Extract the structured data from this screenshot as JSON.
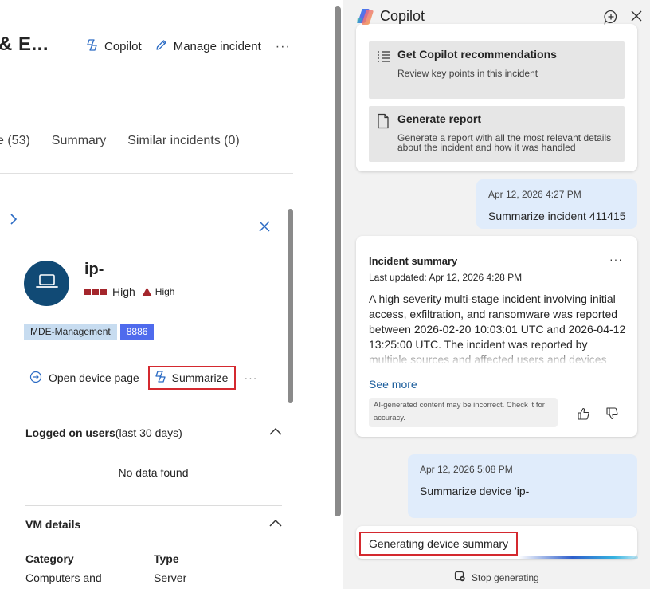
{
  "left": {
    "incident_title": "& E...",
    "actions": {
      "copilot": "Copilot",
      "manage": "Manage incident",
      "more": "···"
    },
    "tabs": [
      "e (53)",
      "Summary",
      "Similar incidents (0)"
    ],
    "device": {
      "name": "ip-",
      "risk_label": "High",
      "exposure_label": "High",
      "tags": [
        "MDE-Management",
        "8886"
      ],
      "open_page": "Open device page",
      "summarize": "Summarize",
      "more": "···"
    },
    "logged_on": {
      "title": "Logged on users",
      "subtitle": "(last 30 days)",
      "empty": "No data found"
    },
    "vm_details": {
      "title": "VM details",
      "category_label": "Category",
      "category_value": "Computers and",
      "type_label": "Type",
      "type_value": "Server"
    }
  },
  "copilot": {
    "title": "Copilot",
    "recommendations": [
      {
        "title": "Get Copilot recommendations",
        "desc": "Review key points in this incident",
        "icon": "list-icon"
      },
      {
        "title": "Generate report",
        "desc": "Generate a report with all the most relevant details about the incident and how it was handled",
        "icon": "document-icon"
      }
    ],
    "prompt1": {
      "time": "Apr 12, 2026 4:27 PM",
      "text": "Summarize incident 411415"
    },
    "summary": {
      "heading": "Incident summary",
      "updated": "Last updated: Apr 12, 2026 4:28 PM",
      "more": "···",
      "body": "A high severity multi-stage incident involving initial access, exfiltration, and ransomware was reported between 2026-02-20 10:03:01 UTC and 2026-04-12 13:25:00 UTC. The incident was reported by multiple sources and affected users and devices including",
      "see_more": "See more",
      "disclaimer": "AI-generated content may be incorrect. Check it for accuracy."
    },
    "prompt2": {
      "time": "Apr 12, 2026 5:08 PM",
      "text": "Summarize device 'ip-"
    },
    "generating": "Generating device summary",
    "stop": "Stop generating"
  },
  "colors": {
    "severity_red": "#a4262c",
    "highlight": "#d4292f",
    "avatar": "#114a75",
    "tag_blue": "#4f6bed",
    "link": "#1c5e9c"
  }
}
